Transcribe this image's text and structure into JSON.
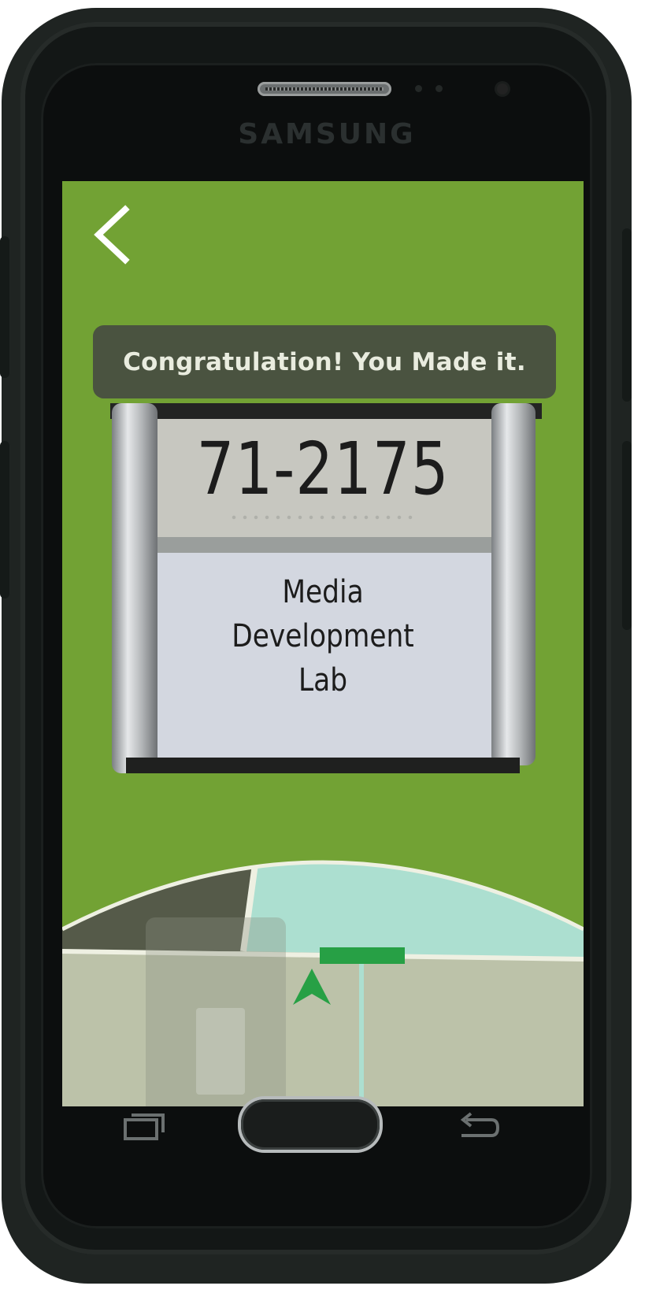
{
  "device": {
    "brand": "SAMSUNG"
  },
  "screen": {
    "background_color": "#72a234",
    "back_button": {
      "icon": "chevron-left-icon"
    },
    "banner": {
      "text": "Congratulation! You Made it.",
      "background_color": "#4a5340",
      "text_color": "#e9ecdf"
    },
    "door_sign": {
      "room_number": "71-2175",
      "room_name_lines": [
        "Media",
        "Development",
        "Lab"
      ]
    },
    "minimap": {
      "user_marker_icon": "navigation-arrow-icon",
      "destination_color": "#27a045",
      "room_highlight_color": "#acdfd0"
    }
  },
  "nav_bar": {
    "recent_icon": "recent-apps-icon",
    "home_icon": "home-button",
    "back_icon": "back-arrow-icon"
  }
}
